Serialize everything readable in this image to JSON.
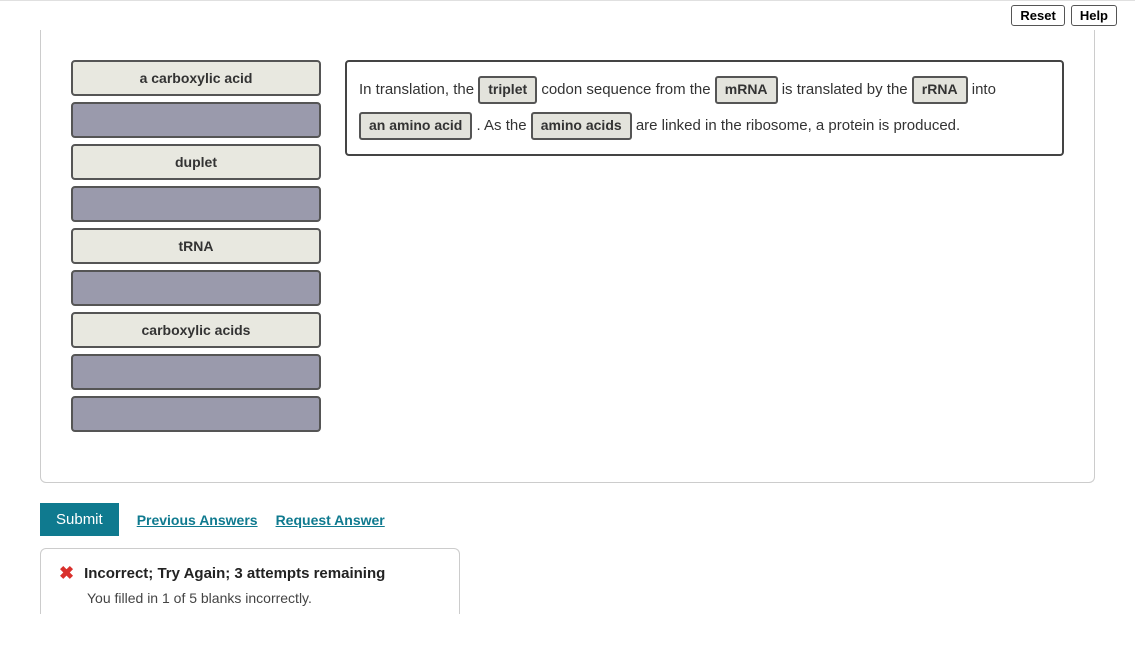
{
  "controls": {
    "reset": "Reset",
    "help": "Help"
  },
  "palette": [
    {
      "label": "a carboxylic acid",
      "state": "available"
    },
    {
      "label": "",
      "state": "empty"
    },
    {
      "label": "duplet",
      "state": "available"
    },
    {
      "label": "",
      "state": "empty"
    },
    {
      "label": "tRNA",
      "state": "available"
    },
    {
      "label": "",
      "state": "empty"
    },
    {
      "label": "carboxylic acids",
      "state": "available"
    },
    {
      "label": "",
      "state": "empty"
    },
    {
      "label": "",
      "state": "empty"
    }
  ],
  "sentence": {
    "seg0": "In translation, the ",
    "drop0": "triplet",
    "seg1": " codon sequence from the ",
    "drop1": "mRNA",
    "seg2": " is translated by the ",
    "drop2": "rRNA",
    "seg3": " into ",
    "drop3": "an amino acid",
    "seg4": " . As the ",
    "drop4": "amino acids",
    "seg5": " are linked in the ribosome, a protein is produced."
  },
  "actions": {
    "submit": "Submit",
    "previous": "Previous Answers",
    "request": "Request Answer"
  },
  "feedback": {
    "title": "Incorrect; Try Again; 3 attempts remaining",
    "detail": "You filled in 1 of 5 blanks incorrectly."
  }
}
